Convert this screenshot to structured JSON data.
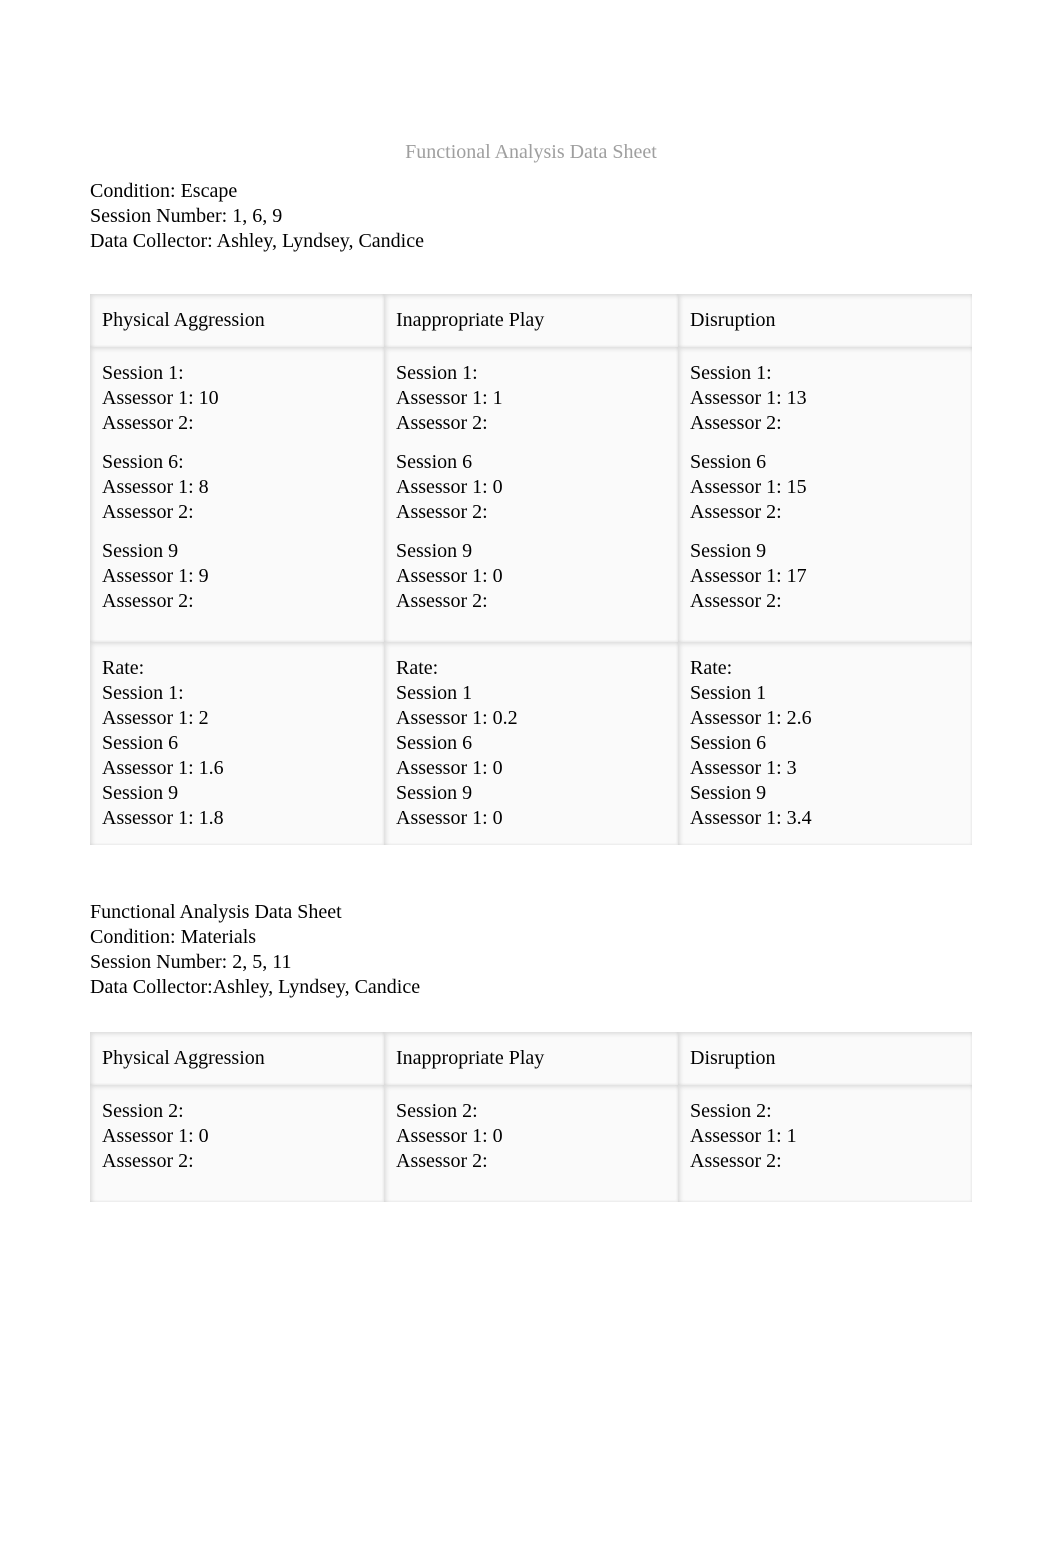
{
  "title": "Functional Analysis Data Sheet",
  "sheet1": {
    "meta": {
      "condition": "Condition: Escape",
      "session_number": "Session Number: 1, 6, 9",
      "collector": "Data Collector: Ashley, Lyndsey, Candice"
    },
    "headers": [
      "Physical Aggression",
      "Inappropriate Play",
      "Disruption"
    ],
    "col1": {
      "s1_label": "Session 1:",
      "s1_a1": "Assessor 1: 10",
      "s1_a2": "Assessor 2:",
      "s2_label": "Session 6:",
      "s2_a1": "Assessor 1: 8",
      "s2_a2": "Assessor 2:",
      "s3_label": "Session 9",
      "s3_a1": "Assessor 1: 9",
      "s3_a2": "Assessor 2:"
    },
    "col2": {
      "s1_label": "Session 1:",
      "s1_a1": "Assessor 1: 1",
      "s1_a2": "Assessor 2:",
      "s2_label": "Session 6",
      "s2_a1": "Assessor 1: 0",
      "s2_a2": "Assessor 2:",
      "s3_label": "Session 9",
      "s3_a1": "Assessor 1: 0",
      "s3_a2": "Assessor 2:"
    },
    "col3": {
      "s1_label": "Session 1:",
      "s1_a1": "Assessor 1: 13",
      "s1_a2": "Assessor 2:",
      "s2_label": "Session 6",
      "s2_a1": "Assessor 1: 15",
      "s2_a2": "Assessor 2:",
      "s3_label": "Session 9",
      "s3_a1": "Assessor 1: 17",
      "s3_a2": "Assessor 2:"
    },
    "rates": {
      "col1": [
        "Rate:",
        "Session 1:",
        "Assessor 1: 2",
        "Session 6",
        "Assessor 1: 1.6",
        "Session 9",
        "Assessor 1: 1.8"
      ],
      "col2": [
        "Rate:",
        "Session 1",
        "Assessor 1: 0.2",
        "Session 6",
        "Assessor 1: 0",
        "Session 9",
        "Assessor 1: 0"
      ],
      "col3": [
        "Rate:",
        "Session 1",
        "Assessor 1: 2.6",
        "Session 6",
        "Assessor 1: 3",
        "Session 9",
        "Assessor 1: 3.4"
      ]
    }
  },
  "sheet2": {
    "meta": {
      "title": "Functional Analysis Data Sheet",
      "condition": "Condition: Materials",
      "session_number": "Session Number: 2, 5, 11",
      "collector_label": "Data Collector:",
      "collector_value": "Ashley, Lyndsey, Candice"
    },
    "headers": [
      "Physical Aggression",
      "Inappropriate Play",
      "Disruption"
    ],
    "col1": {
      "s1_label": "Session 2:",
      "s1_a1": "Assessor 1: 0",
      "s1_a2": "Assessor 2:"
    },
    "col2": {
      "s1_label": "Session 2:",
      "s1_a1": "Assessor 1: 0",
      "s1_a2": "Assessor 2:"
    },
    "col3": {
      "s1_label": "Session 2:",
      "s1_a1": "Assessor 1: 1",
      "s1_a2": "Assessor 2:"
    }
  }
}
